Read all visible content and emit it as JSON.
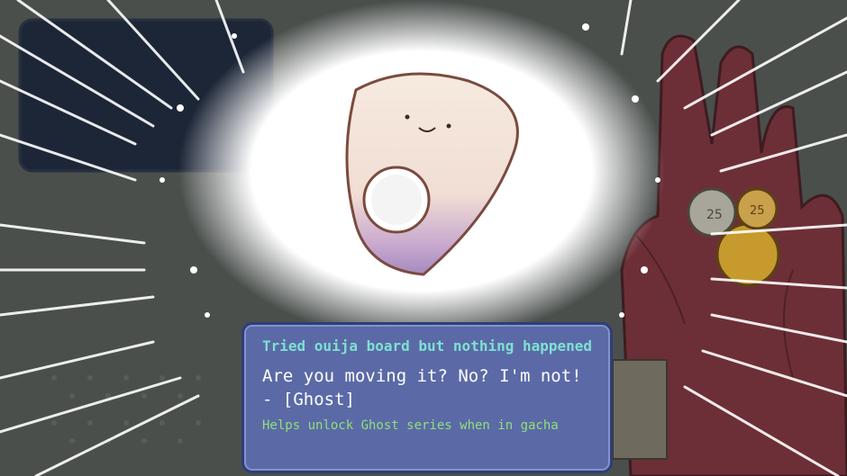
{
  "item_popup": {
    "title": "Tried ouija board but nothing happened",
    "quote": "Are you moving it? No? I'm not! - [Ghost]",
    "hint": "Helps unlock Ghost series when in gacha"
  },
  "item": {
    "name_icon": "planchette-icon",
    "highlight_color": "#ffffff"
  },
  "coins": {
    "denomination_label": "25",
    "icon": "coin-icon"
  },
  "colors": {
    "popup_bg": "#5b6aa6",
    "title": "#7ee0d2",
    "quote": "#ffffff",
    "hint": "#8fe07a"
  }
}
